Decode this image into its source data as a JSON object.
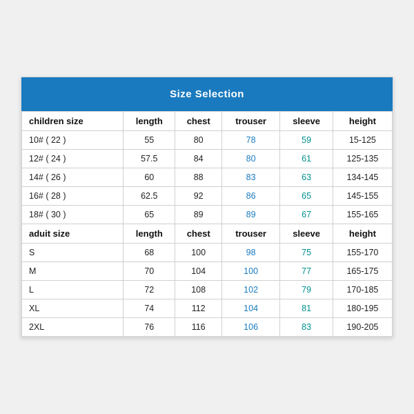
{
  "title": "Size Selection",
  "columns": [
    "children size",
    "length",
    "chest",
    "trouser",
    "sleeve",
    "height"
  ],
  "children_section_header": [
    "children size",
    "length",
    "chest",
    "trouser",
    "sleeve",
    "height"
  ],
  "adult_section_header": [
    "aduit size",
    "length",
    "chest",
    "trouser",
    "sleeve",
    "height"
  ],
  "children_rows": [
    [
      "10# ( 22 )",
      "55",
      "80",
      "78",
      "59",
      "15-125"
    ],
    [
      "12# ( 24 )",
      "57.5",
      "84",
      "80",
      "61",
      "125-135"
    ],
    [
      "14# ( 26 )",
      "60",
      "88",
      "83",
      "63",
      "134-145"
    ],
    [
      "16# ( 28 )",
      "62.5",
      "92",
      "86",
      "65",
      "145-155"
    ],
    [
      "18# ( 30 )",
      "65",
      "89",
      "89",
      "67",
      "155-165"
    ]
  ],
  "adult_rows": [
    [
      "S",
      "68",
      "100",
      "98",
      "75",
      "155-170"
    ],
    [
      "M",
      "70",
      "104",
      "100",
      "77",
      "165-175"
    ],
    [
      "L",
      "72",
      "108",
      "102",
      "79",
      "170-185"
    ],
    [
      "XL",
      "74",
      "112",
      "104",
      "81",
      "180-195"
    ],
    [
      "2XL",
      "76",
      "116",
      "106",
      "83",
      "190-205"
    ]
  ]
}
